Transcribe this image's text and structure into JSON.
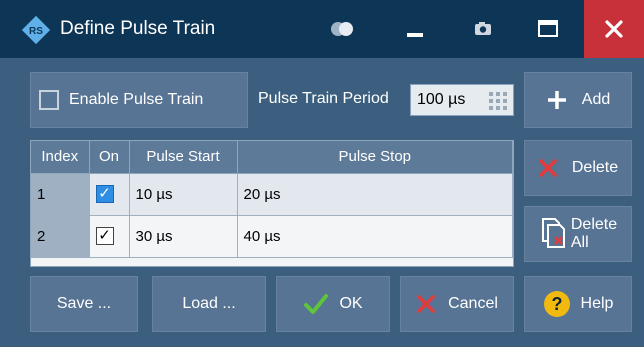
{
  "window": {
    "title": "Define Pulse Train"
  },
  "controls": {
    "enable_label": "Enable Pulse Train",
    "enable_checked": false,
    "period_label": "Pulse Train Period",
    "period_value": "100 µs"
  },
  "table": {
    "headers": [
      "Index",
      "On",
      "Pulse Start",
      "Pulse Stop"
    ],
    "rows": [
      {
        "index": "1",
        "on": true,
        "start": "10 µs",
        "stop": "20 µs"
      },
      {
        "index": "2",
        "on": true,
        "start": "30 µs",
        "stop": "40 µs"
      }
    ]
  },
  "side_buttons": {
    "add": "Add",
    "delete": "Delete",
    "delete_all_line1": "Delete",
    "delete_all_line2": "All"
  },
  "bottom_buttons": {
    "save": "Save ...",
    "load": "Load ...",
    "ok": "OK",
    "cancel": "Cancel",
    "help": "Help"
  },
  "icons": {
    "logo": "rohde-schwarz-logo",
    "toggle": "toggle-icon",
    "minimize": "minimize-icon",
    "screenshot": "camera-icon",
    "maximize": "maximize-icon",
    "close": "close-icon"
  },
  "colors": {
    "titlebar": "#0d3556",
    "background": "#3d5f7f",
    "close": "#c8303a",
    "ok_check": "#5ec43a",
    "cancel_x": "#e23b3b",
    "help": "#f2b90f"
  }
}
